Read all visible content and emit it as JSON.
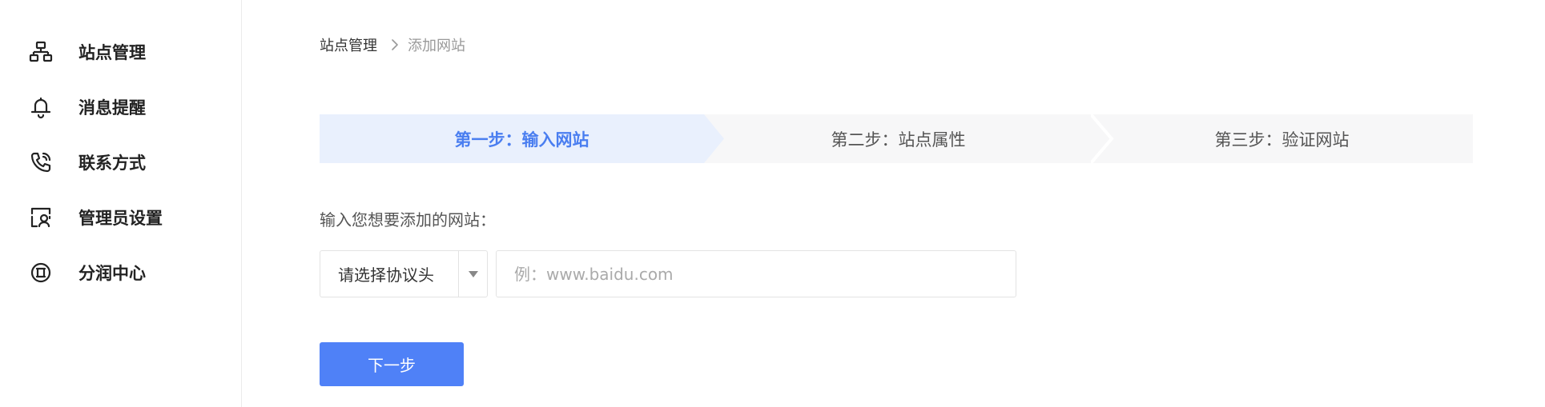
{
  "sidebar": {
    "items": [
      {
        "label": "站点管理",
        "icon": "sitemap-icon"
      },
      {
        "label": "消息提醒",
        "icon": "bell-icon"
      },
      {
        "label": "联系方式",
        "icon": "phone-icon"
      },
      {
        "label": "管理员设置",
        "icon": "admin-icon"
      },
      {
        "label": "分润中心",
        "icon": "coin-icon"
      }
    ]
  },
  "breadcrumb": {
    "root": "站点管理",
    "current": "添加网站"
  },
  "steps": [
    {
      "label": "第一步：输入网站",
      "active": true
    },
    {
      "label": "第二步：站点属性",
      "active": false
    },
    {
      "label": "第三步：验证网站",
      "active": false
    }
  ],
  "form": {
    "label": "输入您想要添加的网站：",
    "protocol_select": {
      "value": "请选择协议头"
    },
    "url_input": {
      "value": "",
      "placeholder": "例：www.baidu.com"
    },
    "next_button": "下一步"
  },
  "colors": {
    "accent": "#4f81f7",
    "active_step_bg": "#e9f0fd",
    "active_step_text": "#4a7ef0",
    "steps_bg": "#f7f7f8"
  }
}
